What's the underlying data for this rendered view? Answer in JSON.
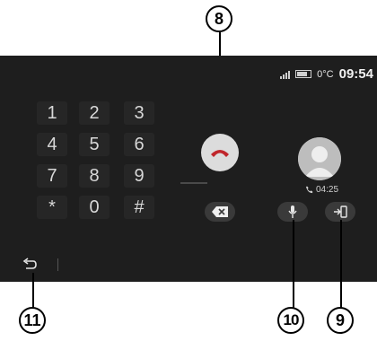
{
  "status": {
    "time": "09:54",
    "temperature": "0°C"
  },
  "keypad": {
    "keys": [
      [
        "1",
        "2",
        "3"
      ],
      [
        "4",
        "5",
        "6"
      ],
      [
        "7",
        "8",
        "9"
      ],
      [
        "*",
        "0",
        "#"
      ]
    ]
  },
  "call": {
    "duration": "04:25"
  },
  "callouts": {
    "hangup": "8",
    "transfer": "9",
    "mic": "10",
    "back": "11"
  },
  "icons": {
    "hangup": "phone-hangup-icon",
    "backspace": "backspace-icon",
    "mic": "microphone-icon",
    "transfer": "transfer-call-icon",
    "back": "back-arrow-icon",
    "avatar": "contact-avatar-icon"
  }
}
